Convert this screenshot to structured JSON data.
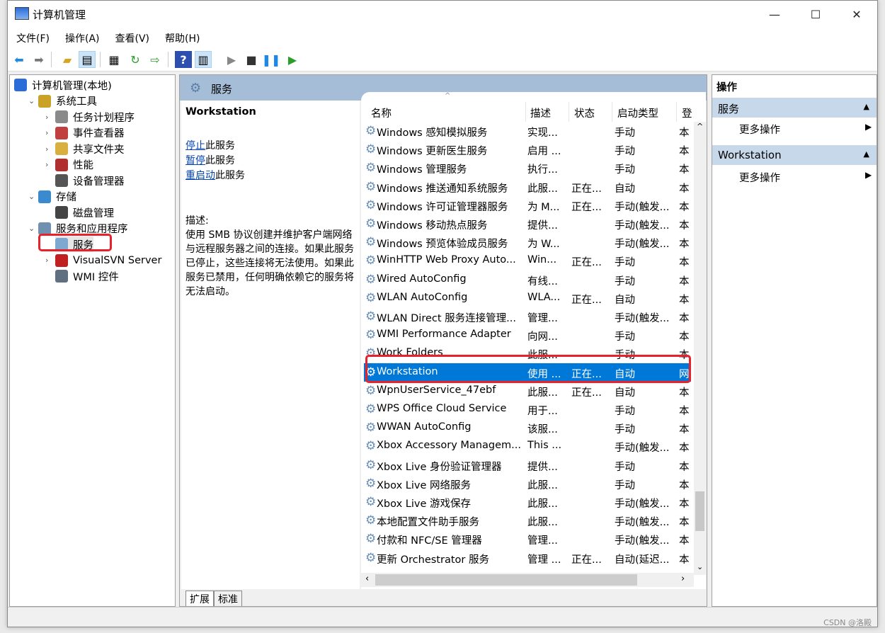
{
  "window": {
    "title": "计算机管理",
    "controls": [
      "minimize",
      "maximize",
      "close"
    ]
  },
  "menu": [
    "文件(F)",
    "操作(A)",
    "查看(V)",
    "帮助(H)"
  ],
  "toolbar": [
    "back-arrow-icon",
    "forward-arrow-icon",
    "up-folder-icon",
    "show-hide-tree-icon",
    "properties-icon",
    "refresh-icon",
    "export-list-icon",
    "help-icon",
    "show-hide-action-pane-icon",
    "start-service-icon",
    "stop-service-icon",
    "pause-service-icon",
    "resume-service-icon"
  ],
  "tree": [
    {
      "label": "计算机管理(本地)",
      "level": 0,
      "chev": ""
    },
    {
      "label": "系统工具",
      "level": 1,
      "chev": "⌄"
    },
    {
      "label": "任务计划程序",
      "level": 2,
      "chev": "›"
    },
    {
      "label": "事件查看器",
      "level": 2,
      "chev": "›"
    },
    {
      "label": "共享文件夹",
      "level": 2,
      "chev": "›"
    },
    {
      "label": "性能",
      "level": 2,
      "chev": "›"
    },
    {
      "label": "设备管理器",
      "level": 2,
      "chev": ""
    },
    {
      "label": "存储",
      "level": 1,
      "chev": "⌄"
    },
    {
      "label": "磁盘管理",
      "level": 2,
      "chev": ""
    },
    {
      "label": "服务和应用程序",
      "level": 1,
      "chev": "⌄"
    },
    {
      "label": "服务",
      "level": 2,
      "chev": "",
      "selected": true
    },
    {
      "label": "VisualSVN Server",
      "level": 2,
      "chev": "›"
    },
    {
      "label": "WMI 控件",
      "level": 2,
      "chev": ""
    }
  ],
  "center": {
    "title": "服务",
    "selected_name": "Workstation",
    "links": [
      {
        "link": "停止",
        "rest": "此服务"
      },
      {
        "link": "暂停",
        "rest": "此服务"
      },
      {
        "link": "重启动",
        "rest": "此服务"
      }
    ],
    "desc_label": "描述:",
    "desc_text": "使用 SMB 协议创建并维护客户端网络与远程服务器之间的连接。如果此服务已停止，这些连接将无法使用。如果此服务已禁用，任何明确依赖它的服务将无法启动。",
    "columns": [
      "名称",
      "描述",
      "状态",
      "启动类型",
      "登"
    ],
    "rows": [
      [
        "Windows 感知模拟服务",
        "实现...",
        "",
        "手动",
        "本"
      ],
      [
        "Windows 更新医生服务",
        "启用 ...",
        "",
        "手动",
        "本"
      ],
      [
        "Windows 管理服务",
        "执行...",
        "",
        "手动",
        "本"
      ],
      [
        "Windows 推送通知系统服务",
        "此服...",
        "正在...",
        "自动",
        "本"
      ],
      [
        "Windows 许可证管理器服务",
        "为 M...",
        "正在...",
        "手动(触发...",
        "本"
      ],
      [
        "Windows 移动热点服务",
        "提供...",
        "",
        "手动(触发...",
        "本"
      ],
      [
        "Windows 预览体验成员服务",
        "为 W...",
        "",
        "手动(触发...",
        "本"
      ],
      [
        "WinHTTP Web Proxy Auto...",
        "Win...",
        "正在...",
        "手动",
        "本"
      ],
      [
        "Wired AutoConfig",
        "有线...",
        "",
        "手动",
        "本"
      ],
      [
        "WLAN AutoConfig",
        "WLA...",
        "正在...",
        "自动",
        "本"
      ],
      [
        "WLAN Direct 服务连接管理...",
        "管理...",
        "",
        "手动(触发...",
        "本"
      ],
      [
        "WMI Performance Adapter",
        "向网...",
        "",
        "手动",
        "本"
      ],
      [
        "Work Folders",
        "此服...",
        "",
        "手动",
        "本"
      ],
      [
        "Workstation",
        "使用 ...",
        "正在...",
        "自动",
        "网"
      ],
      [
        "WpnUserService_47ebf",
        "此服...",
        "正在...",
        "自动",
        "本"
      ],
      [
        "WPS Office Cloud Service",
        "用于...",
        "",
        "手动",
        "本"
      ],
      [
        "WWAN AutoConfig",
        "该服...",
        "",
        "手动",
        "本"
      ],
      [
        "Xbox Accessory Managem...",
        "This ...",
        "",
        "手动(触发...",
        "本"
      ],
      [
        "Xbox Live 身份验证管理器",
        "提供...",
        "",
        "手动",
        "本"
      ],
      [
        "Xbox Live 网络服务",
        "此服...",
        "",
        "手动",
        "本"
      ],
      [
        "Xbox Live 游戏保存",
        "此服...",
        "",
        "手动(触发...",
        "本"
      ],
      [
        "本地配置文件助手服务",
        "此服...",
        "",
        "手动(触发...",
        "本"
      ],
      [
        "付款和 NFC/SE 管理器",
        "管理...",
        "",
        "手动(触发...",
        "本"
      ],
      [
        "更新 Orchestrator 服务",
        "管理 ...",
        "正在...",
        "自动(延迟...",
        "本"
      ]
    ],
    "selected_row": 13,
    "tabs": [
      "扩展",
      "标准"
    ]
  },
  "actions": {
    "title": "操作",
    "sections": [
      {
        "header": "服务",
        "item": "更多操作"
      },
      {
        "header": "Workstation",
        "item": "更多操作"
      }
    ]
  },
  "watermark": "CSDN @洛殿",
  "colors": {
    "selection": "#0078d7",
    "header_band": "#a6bdd7",
    "annotation": "#e8212b"
  }
}
